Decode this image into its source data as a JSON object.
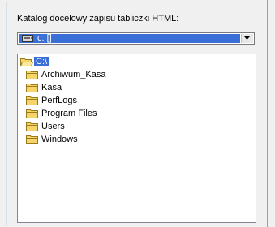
{
  "label": "Katalog docelowy zapisu tabliczki HTML:",
  "drive_combo": {
    "selected": "c: []",
    "icon": "drive-icon"
  },
  "folders": [
    {
      "name": "C:\\",
      "icon": "open-folder-icon",
      "level": 0,
      "selected": true
    },
    {
      "name": "Archiwum_Kasa",
      "icon": "folder-icon",
      "level": 1
    },
    {
      "name": "Kasa",
      "icon": "folder-icon",
      "level": 1
    },
    {
      "name": "PerfLogs",
      "icon": "folder-icon",
      "level": 1
    },
    {
      "name": "Program Files",
      "icon": "folder-icon",
      "level": 1
    },
    {
      "name": "Users",
      "icon": "folder-icon",
      "level": 1
    },
    {
      "name": "Windows",
      "icon": "folder-icon",
      "level": 1
    }
  ],
  "colors": {
    "selection": "#3a6fd8",
    "folder": "#f5d469",
    "folder_outline": "#9a7a1a"
  }
}
